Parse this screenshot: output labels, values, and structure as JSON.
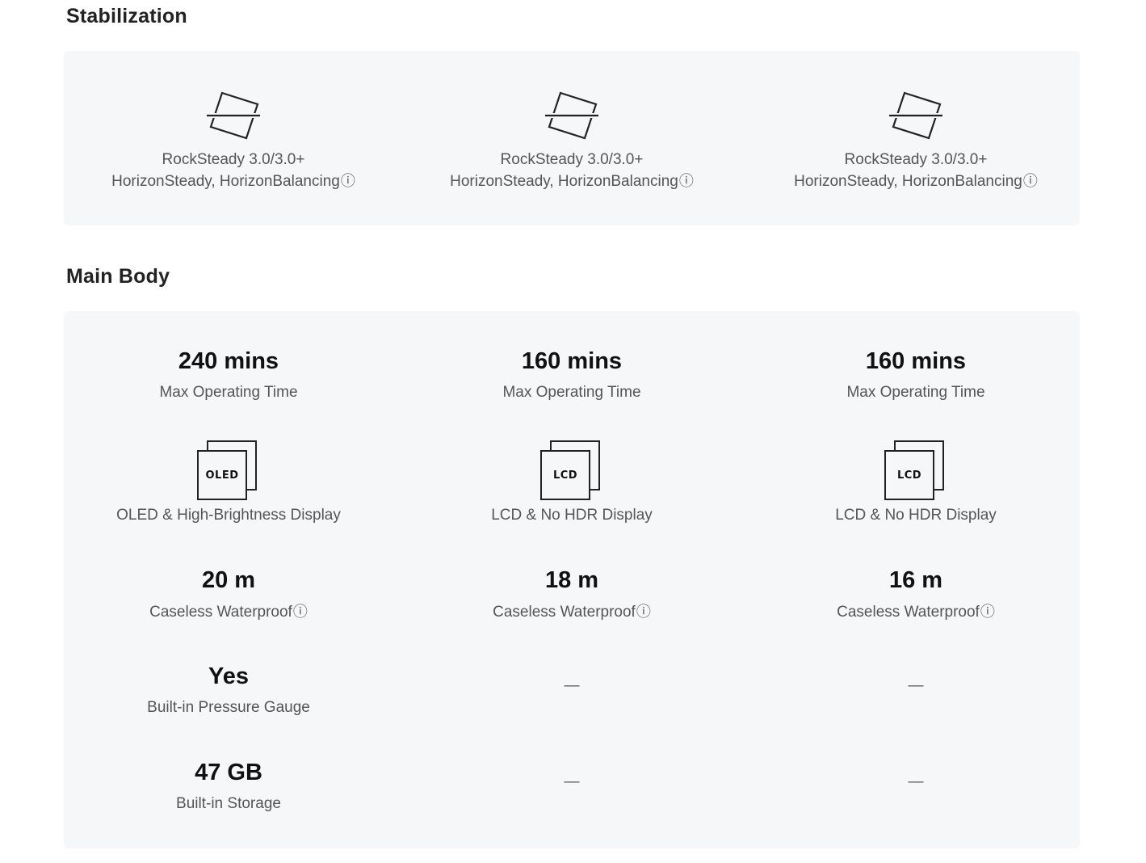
{
  "sections": {
    "stabilization": {
      "title": "Stabilization",
      "columns": [
        {
          "line1": "RockSteady 3.0/3.0+",
          "line2": "HorizonSteady, HorizonBalancing",
          "icon": "stabilization-icon"
        },
        {
          "line1": "RockSteady 3.0/3.0+",
          "line2": "HorizonSteady, HorizonBalancing",
          "icon": "stabilization-icon"
        },
        {
          "line1": "RockSteady 3.0/3.0+",
          "line2": "HorizonSteady, HorizonBalancing",
          "icon": "stabilization-icon"
        }
      ]
    },
    "main_body": {
      "title": "Main Body",
      "columns": [
        {
          "operating_time": {
            "value": "240 mins",
            "label": "Max Operating Time"
          },
          "display": {
            "badge": "OLED",
            "label": "OLED & High-Brightness Display"
          },
          "waterproof": {
            "value": "20 m",
            "label": "Caseless Waterproof"
          },
          "pressure_gauge": {
            "value": "Yes",
            "label": "Built-in Pressure Gauge"
          },
          "storage": {
            "value": "47 GB",
            "label": "Built-in Storage"
          }
        },
        {
          "operating_time": {
            "value": "160 mins",
            "label": "Max Operating Time"
          },
          "display": {
            "badge": "LCD",
            "label": "LCD & No HDR Display"
          },
          "waterproof": {
            "value": "18 m",
            "label": "Caseless Waterproof"
          },
          "pressure_gauge": {
            "dash": "—"
          },
          "storage": {
            "dash": "—"
          }
        },
        {
          "operating_time": {
            "value": "160 mins",
            "label": "Max Operating Time"
          },
          "display": {
            "badge": "LCD",
            "label": "LCD & No HDR Display"
          },
          "waterproof": {
            "value": "16 m",
            "label": "Caseless Waterproof"
          },
          "pressure_gauge": {
            "dash": "—"
          },
          "storage": {
            "dash": "—"
          }
        }
      ]
    }
  },
  "info_glyph": "ⓘ"
}
